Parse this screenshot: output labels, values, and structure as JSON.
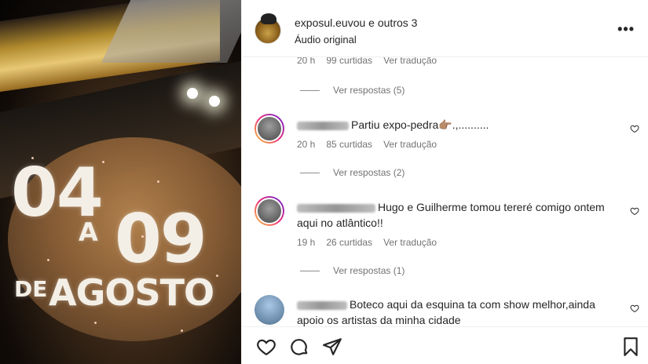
{
  "video": {
    "day_start": "04",
    "connector": "A",
    "day_end": "09",
    "month_prefix": "DE",
    "month": "AGOSTO"
  },
  "header": {
    "account": "exposul.euvou e outros 3",
    "audio": "Áudio original",
    "more_icon": "more-horizontal-icon"
  },
  "comments": {
    "top_partial_meta": {
      "time": "20 h",
      "likes": "99 curtidas",
      "translate": "Ver tradução"
    },
    "top_partial_replies": "Ver respostas (5)",
    "items": [
      {
        "text": "Partiu expo-pedra👉🏽.,..........",
        "time": "20 h",
        "likes": "85 curtidas",
        "translate": "Ver tradução",
        "replies": "Ver respostas (2)"
      },
      {
        "text": "Hugo e Guilherme tomou tereré comigo ontem aqui no atlântico!!",
        "time": "19 h",
        "likes": "26 curtidas",
        "translate": "Ver tradução",
        "replies": "Ver respostas (1)"
      },
      {
        "text": "Boteco aqui da esquina ta com show melhor,ainda apoio os artistas da minha cidade"
      }
    ]
  },
  "footer": {
    "icons": [
      "heart-icon",
      "comment-icon",
      "share-icon",
      "bookmark-icon"
    ]
  }
}
